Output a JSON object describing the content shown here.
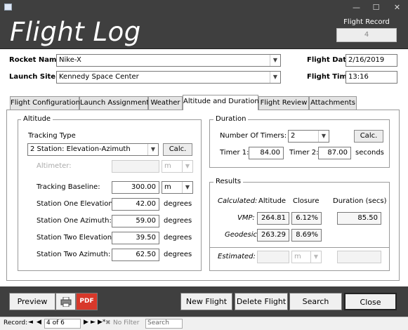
{
  "window": {
    "min": "—",
    "max": "☐",
    "close": "✕"
  },
  "header": {
    "title": "Flight Log",
    "record_label": "Flight Record",
    "record_value": "4"
  },
  "form": {
    "rocket_name_label": "Rocket Name:",
    "rocket_name": "Nike-X",
    "launch_site_label": "Launch Site:",
    "launch_site": "Kennedy Space Center",
    "flight_date_label": "Flight Date:",
    "flight_date": "2/16/2019",
    "flight_time_label": "Flight Time:",
    "flight_time": "13:16"
  },
  "tabs": [
    "Flight Configuration",
    "Launch Assignment",
    "Weather",
    "Altitude and Duration",
    "Flight Review",
    "Attachments"
  ],
  "altitude": {
    "title": "Altitude",
    "tracking_type_label": "Tracking Type",
    "tracking_type": "2 Station: Elevation-Azimuth",
    "calc_label": "Calc.",
    "altimeter_label": "Altimeter:",
    "altimeter_unit": "m",
    "baseline_label": "Tracking Baseline:",
    "baseline": "300.00",
    "baseline_unit": "m",
    "s1_elev_label": "Station One Elevation:",
    "s1_elev": "42.00",
    "s1_az_label": "Station One Azimuth:",
    "s1_az": "59.00",
    "s2_elev_label": "Station Two Elevation:",
    "s2_elev": "39.50",
    "s2_az_label": "Station Two Azimuth:",
    "s2_az": "62.50",
    "deg": "degrees"
  },
  "duration": {
    "title": "Duration",
    "num_timers_label": "Number Of Timers:",
    "num_timers": "2",
    "calc_label": "Calc.",
    "timer1_label": "Timer 1:",
    "timer1": "84.00",
    "timer2_label": "Timer 2:",
    "timer2": "87.00",
    "seconds": "seconds"
  },
  "results": {
    "title": "Results",
    "calculated_label": "Calculated:",
    "altitude_hdr": "Altitude",
    "closure_hdr": "Closure",
    "duration_hdr": "Duration (secs)",
    "vmp_label": "VMP:",
    "vmp_alt": "264.81",
    "vmp_closure": "6.12%",
    "vmp_duration": "85.50",
    "geodesic_label": "Geodesic:",
    "geo_alt": "263.29",
    "geo_closure": "8.69%",
    "estimated_label": "Estimated:",
    "est_unit": "m"
  },
  "footer": {
    "preview": "Preview",
    "pdf": "PDF",
    "new_flight": "New Flight",
    "delete_flight": "Delete Flight",
    "search": "Search",
    "close": "Close"
  },
  "status": {
    "record_label": "Record:",
    "record_pos": "4 of 6",
    "no_filter": "No Filter",
    "search": "Search"
  }
}
